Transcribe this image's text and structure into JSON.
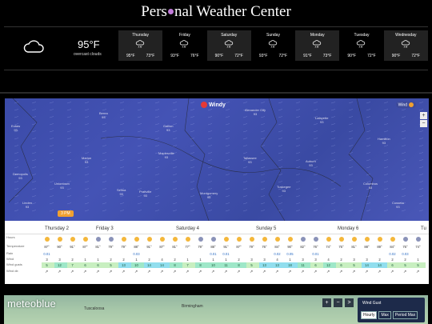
{
  "header": {
    "title_part1": "Pers",
    "title_part2": "nal Weather Center"
  },
  "current": {
    "temp": "95°F",
    "condition": "overcast clouds",
    "icon": "cloud-icon"
  },
  "forecast": [
    {
      "day": "Thursday",
      "hi": "95°F",
      "lo": "73°F",
      "icon": "rain-cloud-icon"
    },
    {
      "day": "Friday",
      "hi": "93°F",
      "lo": "76°F",
      "icon": "rain-cloud-icon"
    },
    {
      "day": "Saturday",
      "hi": "90°F",
      "lo": "72°F",
      "icon": "rain-cloud-icon"
    },
    {
      "day": "Sunday",
      "hi": "93°F",
      "lo": "72°F",
      "icon": "rain-cloud-icon"
    },
    {
      "day": "Monday",
      "hi": "91°F",
      "lo": "73°F",
      "icon": "rain-cloud-icon"
    },
    {
      "day": "Tuesday",
      "hi": "90°F",
      "lo": "72°F",
      "icon": "rain-cloud-icon"
    },
    {
      "day": "Wednesday",
      "hi": "90°F",
      "lo": "72°F",
      "icon": "rain-cloud-icon"
    }
  ],
  "windy": {
    "logo": "Windy",
    "layer": "Wind",
    "zoom_in": "+",
    "zoom_out": "−",
    "time_marker": "3 PM",
    "cities": [
      {
        "name": "Alexander City",
        "val": "93"
      },
      {
        "name": "Lafayette",
        "val": "93"
      },
      {
        "name": "Berea",
        "val": "93"
      },
      {
        "name": "Gallion",
        "val": "93"
      },
      {
        "name": "Maplesville",
        "val": "93"
      },
      {
        "name": "Eutaw",
        "val": "93"
      },
      {
        "name": "Marion",
        "val": "93"
      },
      {
        "name": "Selma",
        "val": "93"
      },
      {
        "name": "Uniontown",
        "val": "93"
      },
      {
        "name": "Demopolis",
        "val": "93"
      },
      {
        "name": "Prattville",
        "val": "93"
      },
      {
        "name": "Montgomery",
        "val": "95"
      },
      {
        "name": "Tuskegee",
        "val": "93"
      },
      {
        "name": "Auburn",
        "val": "93"
      },
      {
        "name": "Columbus",
        "val": "93"
      },
      {
        "name": "Hamilton",
        "val": "93"
      },
      {
        "name": "Cusseta",
        "val": "93"
      },
      {
        "name": "Linden",
        "val": "93"
      },
      {
        "name": "Tallassee",
        "val": "93"
      }
    ],
    "days": [
      "Thursday 2",
      "Friday 3",
      "Saturday 4",
      "Sunday 5",
      "Monday 6",
      "Tu"
    ],
    "row_labels": [
      "Hours",
      "Temperature",
      "Rain",
      "Wind",
      "Wind gusts",
      "Wind dir."
    ],
    "temps": [
      "87°",
      "90°",
      "91°",
      "87°",
      "81°",
      "79°",
      "79°",
      "88°",
      "91°",
      "87°",
      "81°",
      "77°",
      "79°",
      "88°",
      "91°",
      "87°",
      "79°",
      "76°",
      "84°",
      "90°",
      "82°",
      "76°",
      "74°",
      "75°",
      "81°",
      "88°",
      "89°",
      "84°",
      "75°",
      "74°"
    ],
    "rain": [
      "0.01",
      "",
      "",
      "",
      "",
      "",
      "",
      "0.03",
      "",
      "",
      "",
      "",
      "",
      "0.01",
      "0.01",
      "",
      "",
      "",
      "0.02",
      "0.05",
      "",
      "0.01",
      "",
      "",
      "",
      "",
      "",
      "0.02",
      "0.03",
      ""
    ],
    "wind": [
      "3",
      "3",
      "2",
      "1",
      "1",
      "2",
      "2",
      "1",
      "2",
      "4",
      "2",
      "1",
      "1",
      "1",
      "1",
      "2",
      "3",
      "3",
      "4",
      "1",
      "3",
      "3",
      "4",
      "2",
      "3",
      "3",
      "2",
      "2",
      "2",
      "1"
    ],
    "gusts": [
      "5",
      "12",
      "7",
      "6",
      "6",
      "5",
      "13",
      "10",
      "14",
      "14",
      "8",
      "7",
      "8",
      "10",
      "11",
      "8",
      "5",
      "13",
      "13",
      "18",
      "11",
      "6",
      "12",
      "6",
      "5",
      "14",
      "14",
      "6",
      "5",
      "5"
    ]
  },
  "meteoblue": {
    "brand": "meteoblue",
    "layer_title": "Wind Gust",
    "buttons": [
      "Hourly",
      "Max",
      "Period Max"
    ],
    "controls": [
      "+",
      "−",
      ">"
    ],
    "cities": [
      "Birmingham",
      "Tuscaloosa"
    ]
  }
}
